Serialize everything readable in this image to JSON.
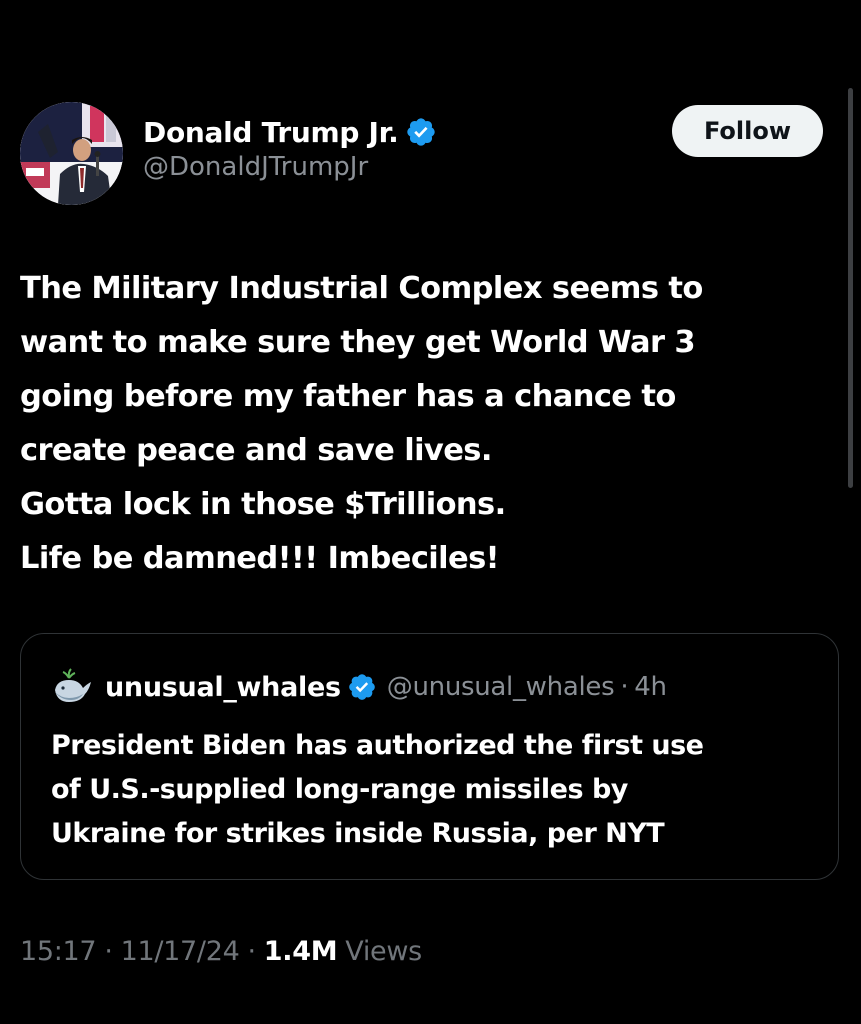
{
  "author": {
    "name": "Donald Trump Jr.",
    "handle": "@DonaldJTrumpJr"
  },
  "follow_label": "Follow",
  "tweet": {
    "lines": [
      "The Military Industrial Complex seems to",
      "want to make sure they get World War 3",
      "going before my father has a chance to",
      "create peace and save lives.",
      "Gotta lock in those $Trillions.",
      "Life be damned!!! Imbeciles!"
    ]
  },
  "quote": {
    "name": "unusual_whales",
    "handle": "@unusual_whales",
    "separator": "·",
    "time": "4h",
    "lines": [
      "President Biden has authorized the first use",
      "of U.S.-supplied long-range missiles by",
      "Ukraine for strikes inside Russia, per NYT"
    ]
  },
  "meta": {
    "time": "15:17",
    "separator": "·",
    "date": "11/17/24",
    "views_count": "1.4M",
    "views_label": "Views"
  },
  "colors": {
    "background": "#000000",
    "verified": "#1d9bf0",
    "secondary_text": "#71767b",
    "follow_bg": "#eff3f4"
  },
  "icons": {
    "verified": "verified-badge-icon",
    "whale": "whale-icon"
  }
}
